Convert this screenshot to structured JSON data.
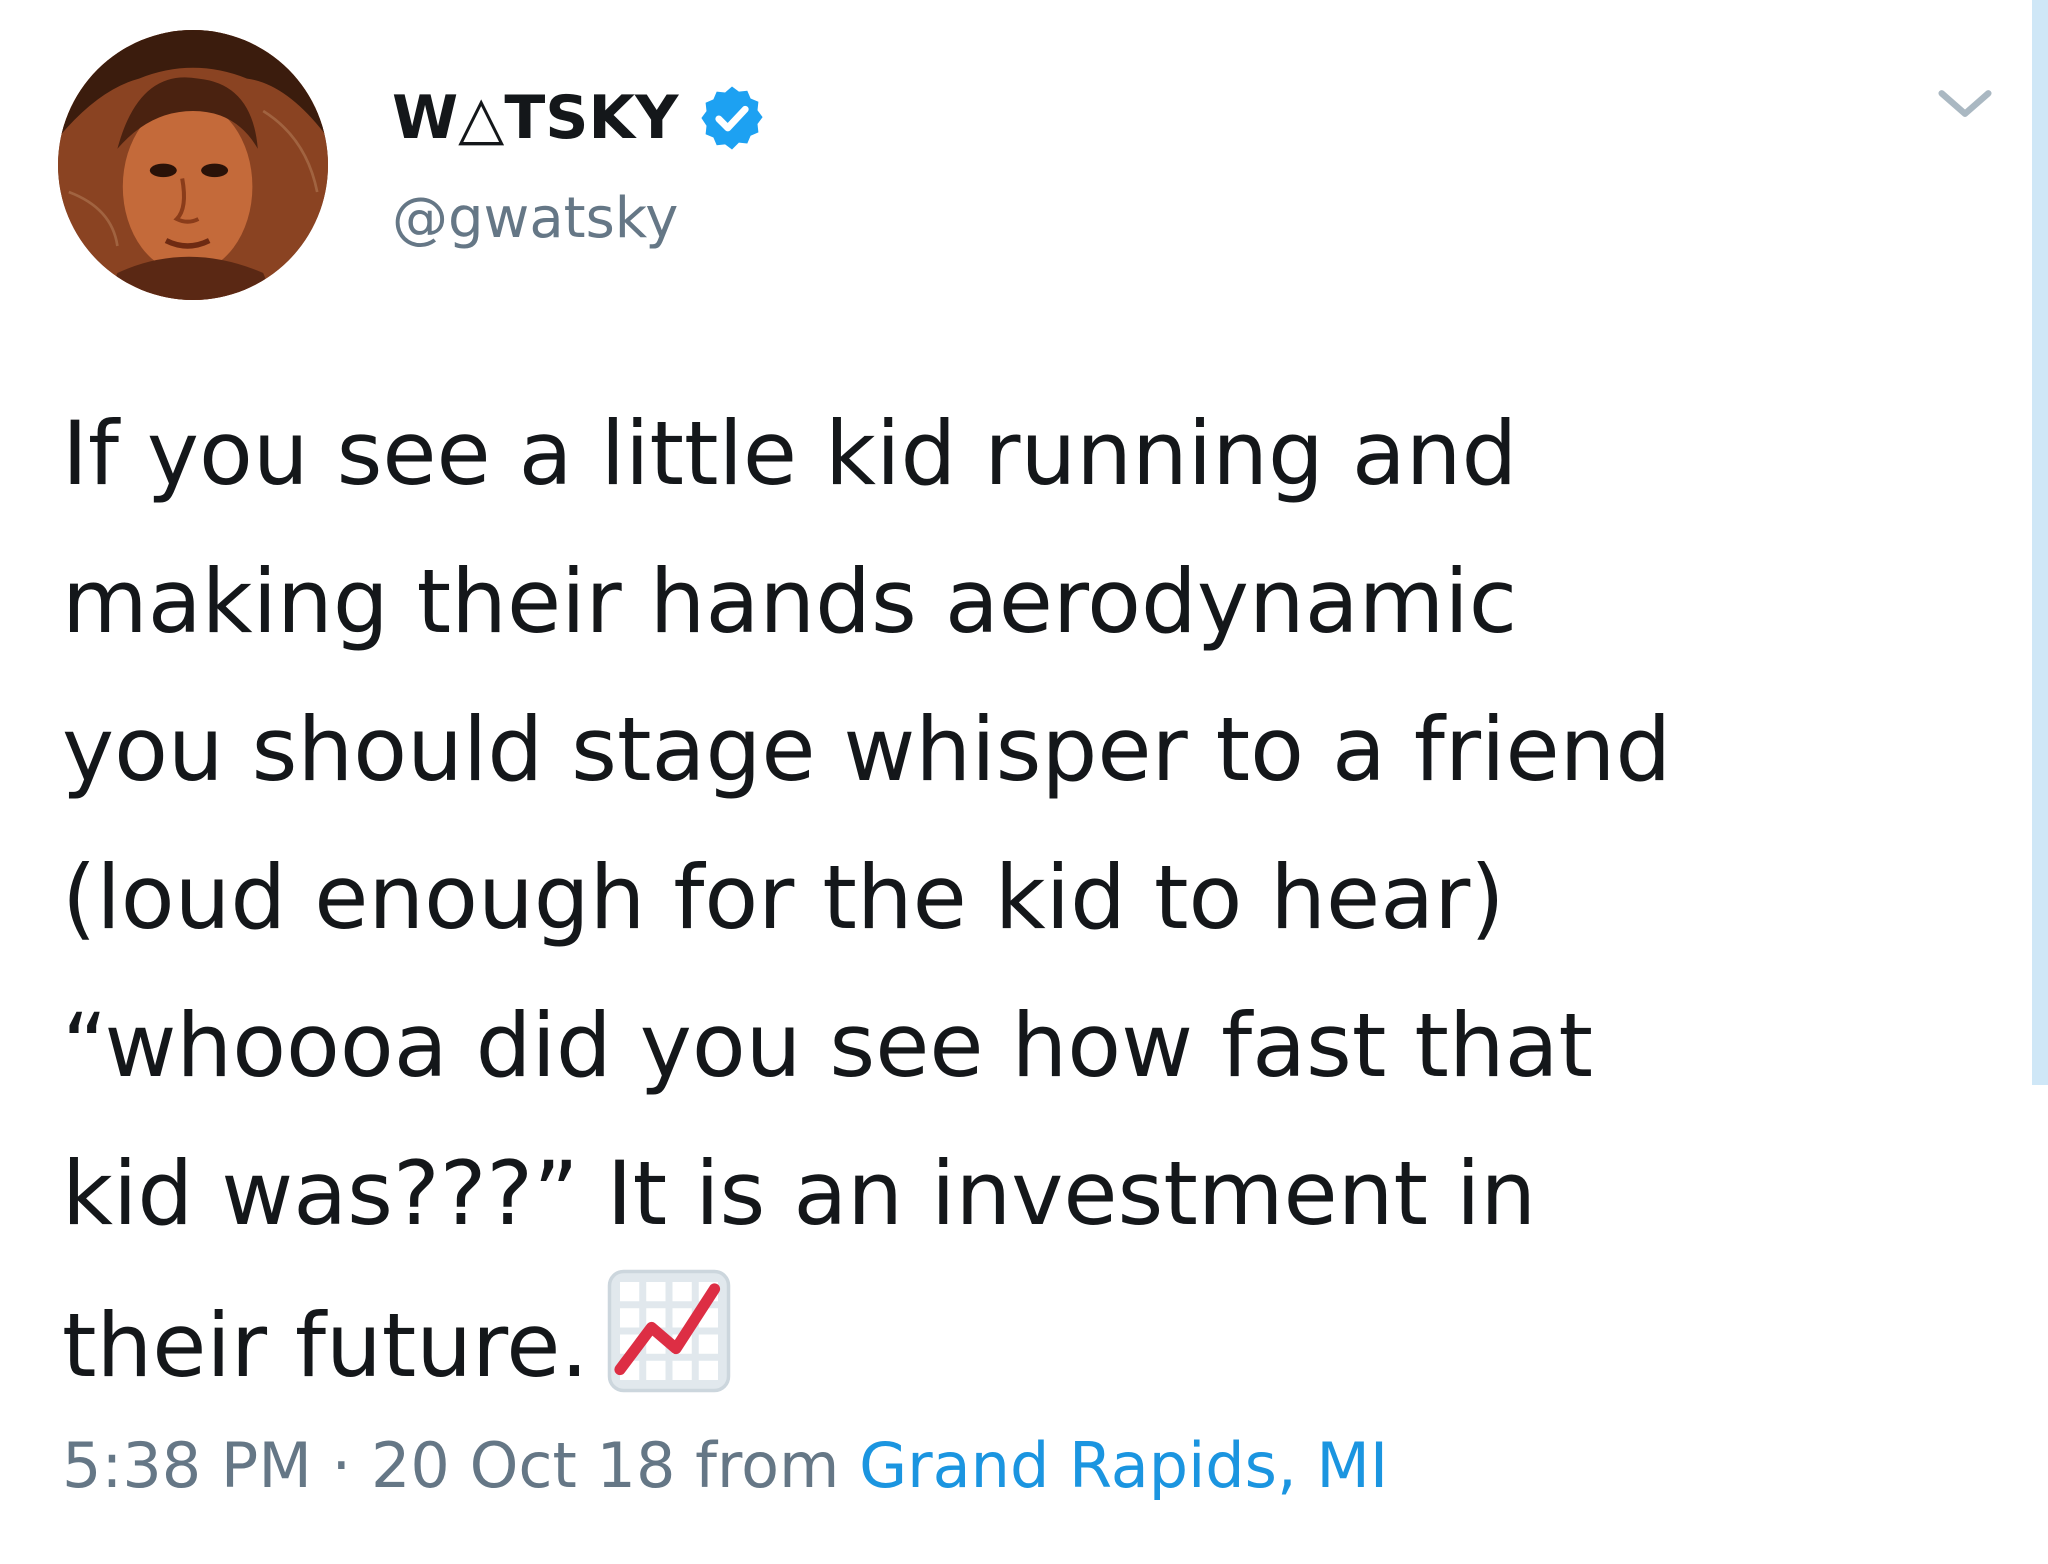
{
  "tweet": {
    "display_name": "W△TSKY",
    "handle": "@gwatsky",
    "text_lines": [
      "If you see a little kid running and",
      "making their hands aerodynamic",
      "you should stage whisper to a friend",
      "(loud enough for the kid to hear)",
      "“whoooa did you see how fast that",
      "kid was???” It is an investment in",
      "their future."
    ],
    "emoji": "chart-increasing-icon",
    "time": "5:38 PM",
    "separator": "·",
    "date": "20 Oct 18",
    "from_label": "from",
    "location": "Grand Rapids, MI"
  },
  "colors": {
    "text": "#14171a",
    "secondary": "#657786",
    "link": "#1b95e0",
    "verified": "#1da1f2"
  }
}
